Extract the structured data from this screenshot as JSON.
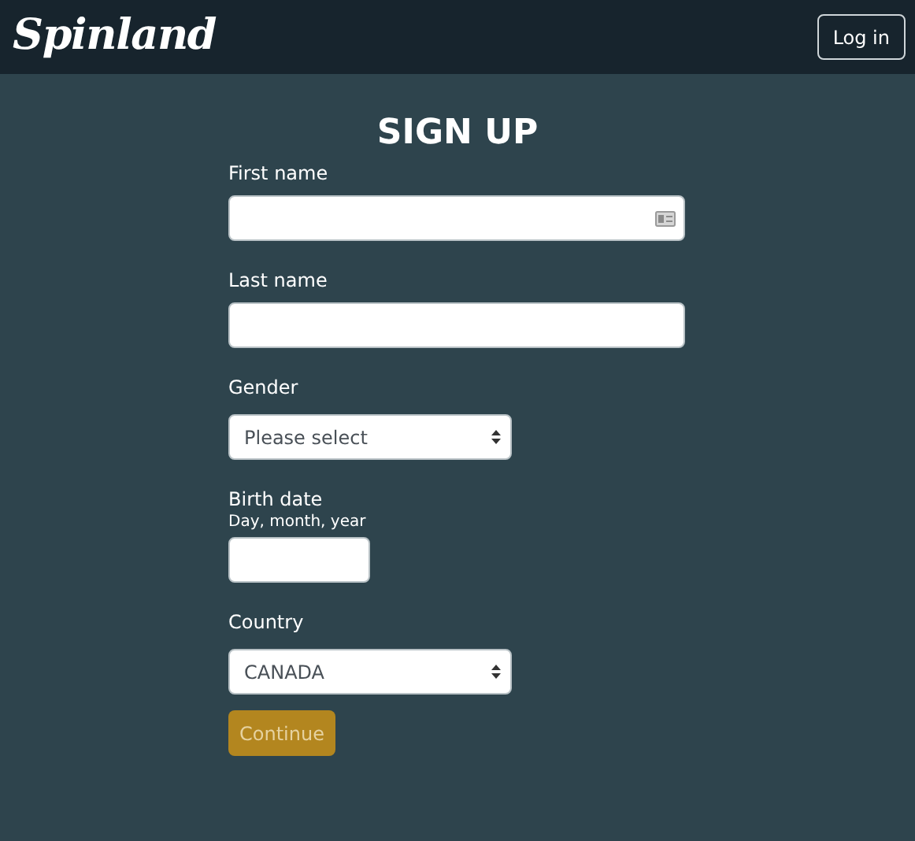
{
  "header": {
    "logo": "Spinland",
    "login_button": "Log in"
  },
  "title": "SIGN UP",
  "fields": [
    {
      "kind": "text",
      "label": "First name",
      "icon": true
    },
    {
      "kind": "text",
      "label": "Last name",
      "icon": false
    },
    {
      "kind": "select",
      "label": "Gender",
      "value": "Please select"
    },
    {
      "kind": "date",
      "label": "Birth date",
      "hint": "Day, month, year"
    },
    {
      "kind": "select",
      "label": "Country",
      "value": "CANADA"
    }
  ],
  "continue_button": {
    "label": "Continue",
    "disabled": true
  }
}
